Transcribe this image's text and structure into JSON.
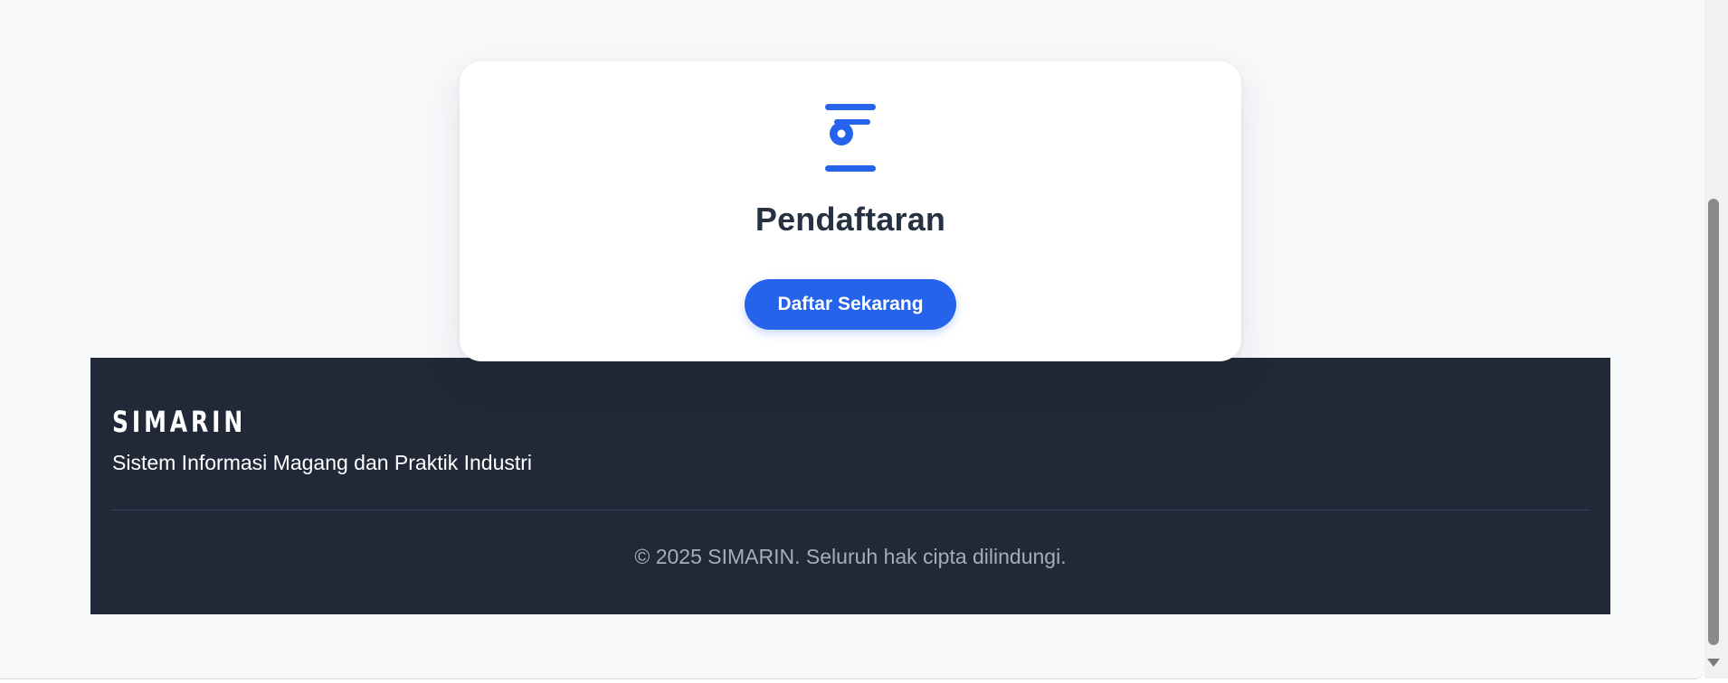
{
  "card": {
    "icon": "registration-icon",
    "title": "Pendaftaran",
    "button_label": "Daftar Sekarang"
  },
  "footer": {
    "brand": "SIMARIN",
    "tagline": "Sistem Informasi Magang dan Praktik Industri",
    "copyright": "© 2025 SIMARIN. Seluruh hak cipta dilindungi."
  },
  "colors": {
    "accent": "#2563eb",
    "footer_bg": "#212938",
    "page_bg": "#f8f9fb",
    "title_text": "#263142",
    "muted_text": "#a4adbb"
  }
}
